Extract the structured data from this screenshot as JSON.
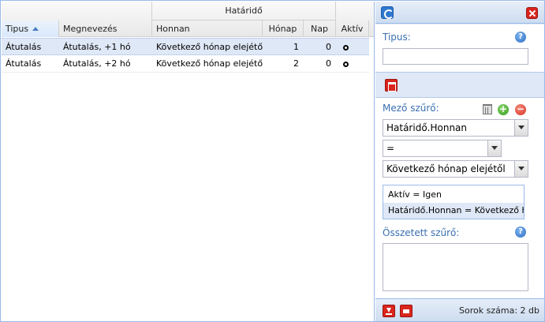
{
  "grid": {
    "group_header": "Határidő",
    "columns": {
      "tipus": "Tipus",
      "megnevezes": "Megnevezés",
      "honnan": "Honnan",
      "honap": "Hónap",
      "nap": "Nap",
      "aktiv": "Aktív"
    },
    "rows": [
      {
        "tipus": "Átutalás",
        "megnevezes": "Átutalás, +1 hó",
        "honnan": "Következő hónap elejétől",
        "honap": "1",
        "nap": "0",
        "aktiv": true
      },
      {
        "tipus": "Átutalás",
        "megnevezes": "Átutalás, +2 hó",
        "honnan": "Következő hónap elejétől",
        "honap": "2",
        "nap": "0",
        "aktiv": true
      }
    ]
  },
  "panel": {
    "tipus_label": "Tipus:",
    "tipus_value": "",
    "mezo_szuro_label": "Mező szűrő:",
    "field_combo": "Határidő.Honnan",
    "operator_combo": "=",
    "value_combo": "Következő hónap elejétől",
    "filters": [
      "Aktív = Igen",
      "Határidő.Honnan = Következő hó..."
    ],
    "osszetett_label": "Összetett szűrő:",
    "osszetett_value": "",
    "row_count": "Sorok száma: 2 db"
  },
  "icons": {
    "refresh": "refresh-icon",
    "close": "close-icon",
    "help": "help-icon",
    "save": "save-icon",
    "trash": "trash-icon",
    "add": "add-icon",
    "remove": "remove-icon",
    "download": "download-icon",
    "print": "print-icon"
  },
  "colors": {
    "accent": "#3a6fb0",
    "selected_row": "#dfe8f6",
    "red_button": "#d9251d"
  }
}
